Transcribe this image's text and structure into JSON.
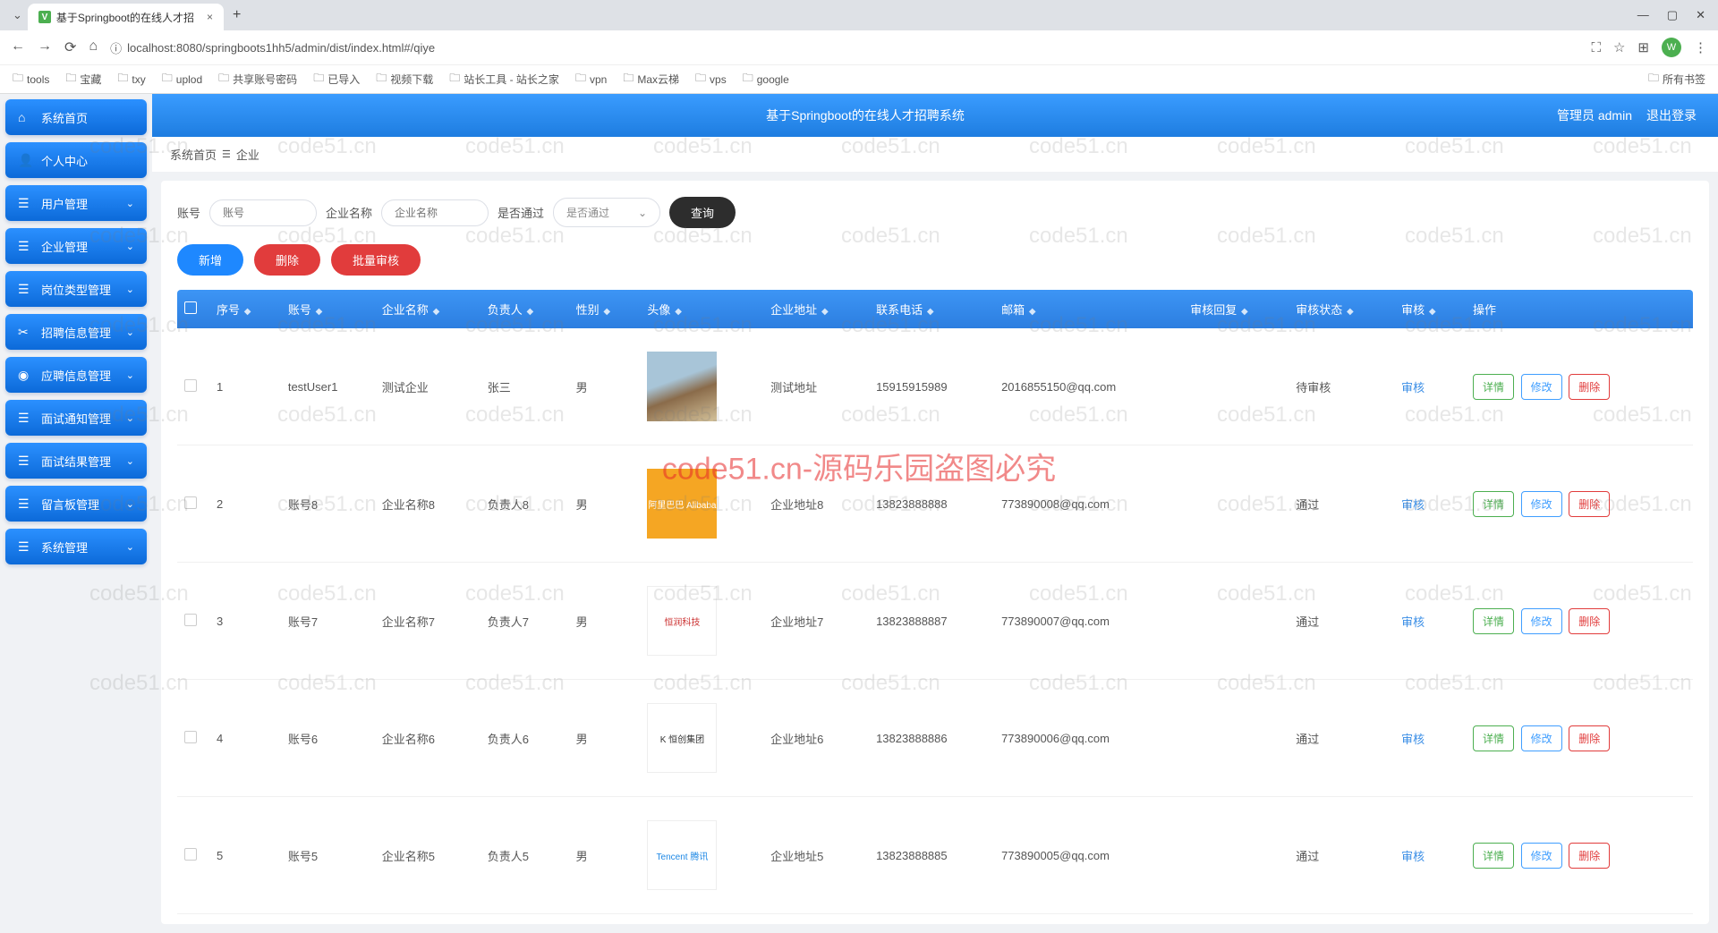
{
  "browser": {
    "tab_title": "基于Springboot的在线人才招",
    "url": "localhost:8080/springboots1hh5/admin/dist/index.html#/qiye",
    "bookmarks": [
      "tools",
      "宝藏",
      "txy",
      "uplod",
      "共享账号密码",
      "已导入",
      "视频下载",
      "站长工具 - 站长之家",
      "vpn",
      "Max云梯",
      "vps",
      "google"
    ],
    "all_bookmarks": "所有书签"
  },
  "app": {
    "title": "基于Springboot的在线人才招聘系统",
    "admin_label": "管理员 admin",
    "logout": "退出登录"
  },
  "sidebar": [
    {
      "icon": "⌂",
      "label": "系统首页",
      "expandable": false
    },
    {
      "icon": "👤",
      "label": "个人中心",
      "expandable": false
    },
    {
      "icon": "☰",
      "label": "用户管理",
      "expandable": true
    },
    {
      "icon": "☰",
      "label": "企业管理",
      "expandable": true
    },
    {
      "icon": "☰",
      "label": "岗位类型管理",
      "expandable": true
    },
    {
      "icon": "✂",
      "label": "招聘信息管理",
      "expandable": true
    },
    {
      "icon": "◉",
      "label": "应聘信息管理",
      "expandable": true
    },
    {
      "icon": "☰",
      "label": "面试通知管理",
      "expandable": true
    },
    {
      "icon": "☰",
      "label": "面试结果管理",
      "expandable": true
    },
    {
      "icon": "☰",
      "label": "留言板管理",
      "expandable": true
    },
    {
      "icon": "☰",
      "label": "系统管理",
      "expandable": true
    }
  ],
  "breadcrumb": {
    "home": "系统首页",
    "sep": "☰",
    "current": "企业"
  },
  "filters": {
    "f1_label": "账号",
    "f1_ph": "账号",
    "f2_label": "企业名称",
    "f2_ph": "企业名称",
    "f3_label": "是否通过",
    "f3_ph": "是否通过",
    "search": "查询"
  },
  "actions": {
    "add": "新增",
    "delete": "删除",
    "batch": "批量审核"
  },
  "columns": [
    "",
    "序号",
    "账号",
    "企业名称",
    "负责人",
    "性别",
    "头像",
    "企业地址",
    "联系电话",
    "邮箱",
    "审核回复",
    "审核状态",
    "审核",
    "操作"
  ],
  "row_buttons": {
    "detail": "详情",
    "edit": "修改",
    "del": "删除"
  },
  "audit_link": "审核",
  "rows": [
    {
      "idx": "1",
      "account": "testUser1",
      "company": "测试企业",
      "manager": "张三",
      "gender": "男",
      "avatar": "av1",
      "avtxt": "",
      "address": "测试地址",
      "phone": "15915915989",
      "email": "2016855150@qq.com",
      "reply": "",
      "status": "待审核"
    },
    {
      "idx": "2",
      "account": "账号8",
      "company": "企业名称8",
      "manager": "负责人8",
      "gender": "男",
      "avatar": "av2",
      "avtxt": "阿里巴巴 Alibaba",
      "address": "企业地址8",
      "phone": "13823888888",
      "email": "773890008@qq.com",
      "reply": "",
      "status": "通过"
    },
    {
      "idx": "3",
      "account": "账号7",
      "company": "企业名称7",
      "manager": "负责人7",
      "gender": "男",
      "avatar": "av3",
      "avtxt": "恒润科技",
      "address": "企业地址7",
      "phone": "13823888887",
      "email": "773890007@qq.com",
      "reply": "",
      "status": "通过"
    },
    {
      "idx": "4",
      "account": "账号6",
      "company": "企业名称6",
      "manager": "负责人6",
      "gender": "男",
      "avatar": "av4",
      "avtxt": "K 恒创集团",
      "address": "企业地址6",
      "phone": "13823888886",
      "email": "773890006@qq.com",
      "reply": "",
      "status": "通过"
    },
    {
      "idx": "5",
      "account": "账号5",
      "company": "企业名称5",
      "manager": "负责人5",
      "gender": "男",
      "avatar": "av5",
      "avtxt": "Tencent 腾讯",
      "address": "企业地址5",
      "phone": "13823888885",
      "email": "773890005@qq.com",
      "reply": "",
      "status": "通过"
    }
  ],
  "watermark": "code51.cn",
  "watermark_center": "code51.cn-源码乐园盗图必究"
}
